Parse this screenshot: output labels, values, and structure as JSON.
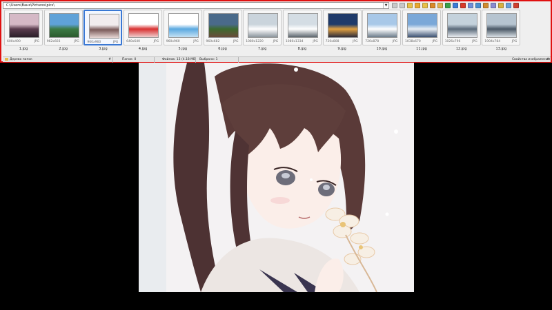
{
  "path_bar": {
    "value": "C:\\Users\\Ваня\\Pictures\\pics\\"
  },
  "toolbar": {
    "buttons": [
      {
        "icon": "nav-back-icon",
        "color": "#c8c8c8"
      },
      {
        "icon": "nav-forward-icon",
        "color": "#c8c8c8"
      },
      {
        "icon": "folder-up-icon",
        "color": "#e8c04a"
      },
      {
        "icon": "favorites-icon",
        "color": "#e9a830"
      },
      {
        "icon": "folder-icon",
        "color": "#e8c04a"
      },
      {
        "icon": "cut-icon",
        "color": "#d98a2a"
      },
      {
        "icon": "copy-icon",
        "color": "#e0b050"
      },
      {
        "icon": "refresh-icon",
        "color": "#3aa04a"
      },
      {
        "icon": "globe-icon",
        "color": "#3c7bd6"
      },
      {
        "icon": "delete-icon",
        "color": "#d83a2a"
      },
      {
        "icon": "rename-icon",
        "color": "#6f8fd8"
      },
      {
        "icon": "sort-icon",
        "color": "#4a8fd0"
      },
      {
        "icon": "filter-icon",
        "color": "#d08a30"
      },
      {
        "icon": "view-icon",
        "color": "#8a8ad0"
      },
      {
        "icon": "mail-icon",
        "color": "#d8b040"
      },
      {
        "icon": "options-icon",
        "color": "#6aa0d8"
      },
      {
        "icon": "close-icon",
        "color": "#d04030"
      }
    ]
  },
  "thumbnails": [
    {
      "name": "1.jpg",
      "dims": "600x490",
      "format": "JPG",
      "colors": [
        "#d5b9c6",
        "#5a3c4e",
        "#2a1e28"
      ]
    },
    {
      "name": "2.jpg",
      "dims": "962x603",
      "format": "JPG",
      "colors": [
        "#5fa2d8",
        "#3c7a44",
        "#2b5a2e"
      ]
    },
    {
      "name": "3.jpg",
      "dims": "960x960",
      "format": "JPG",
      "colors": [
        "#f1ecee",
        "#7a5a5a",
        "#e8d8d6"
      ],
      "selected": true
    },
    {
      "name": "4.jpg",
      "dims": "640x640",
      "format": "JPG",
      "colors": [
        "#ffffff",
        "#d83030",
        "#f0d0d0"
      ]
    },
    {
      "name": "5.jpg",
      "dims": "960x960",
      "format": "JPG",
      "colors": [
        "#ffffff",
        "#5aa8e0",
        "#c6e2f4"
      ]
    },
    {
      "name": "6.jpg",
      "dims": "960x682",
      "format": "JPG",
      "colors": [
        "#4a6a8a",
        "#3d6a2e",
        "#6a4a3a"
      ]
    },
    {
      "name": "7.jpg",
      "dims": "1080x1220",
      "format": "JPG",
      "colors": [
        "#cad4dc",
        "#ffffff",
        "#8a949c"
      ]
    },
    {
      "name": "8.jpg",
      "dims": "1080x1334",
      "format": "JPG",
      "colors": [
        "#d4dde4",
        "#ffffff",
        "#5a646c"
      ]
    },
    {
      "name": "9.jpg",
      "dims": "720x808",
      "format": "JPG",
      "colors": [
        "#1e3a6a",
        "#e0a040",
        "#2a2a3a"
      ]
    },
    {
      "name": "10.jpg",
      "dims": "720x878",
      "format": "JPG",
      "colors": [
        "#a8c8e8",
        "#ffffff",
        "#6a7a8a"
      ]
    },
    {
      "name": "11.jpg",
      "dims": "1038x670",
      "format": "JPG",
      "colors": [
        "#7aa8d8",
        "#e8eef4",
        "#3a5070"
      ]
    },
    {
      "name": "12.jpg",
      "dims": "1026x796",
      "format": "JPG",
      "colors": [
        "#c4d2dc",
        "#5a6a7a",
        "#ecf0f4"
      ]
    },
    {
      "name": "13.jpg",
      "dims": "1904x784",
      "format": "JPG",
      "colors": [
        "#b6c4d0",
        "#4a5866",
        "#dde4ea"
      ]
    }
  ],
  "status_bar": {
    "folder_tree_label": "Дерево папок",
    "folders": "Папок: 0",
    "files": "Файлов: 13 (4.18 MB)",
    "selected": "Выбрано: 1",
    "image_properties": "Свойства изображения"
  }
}
